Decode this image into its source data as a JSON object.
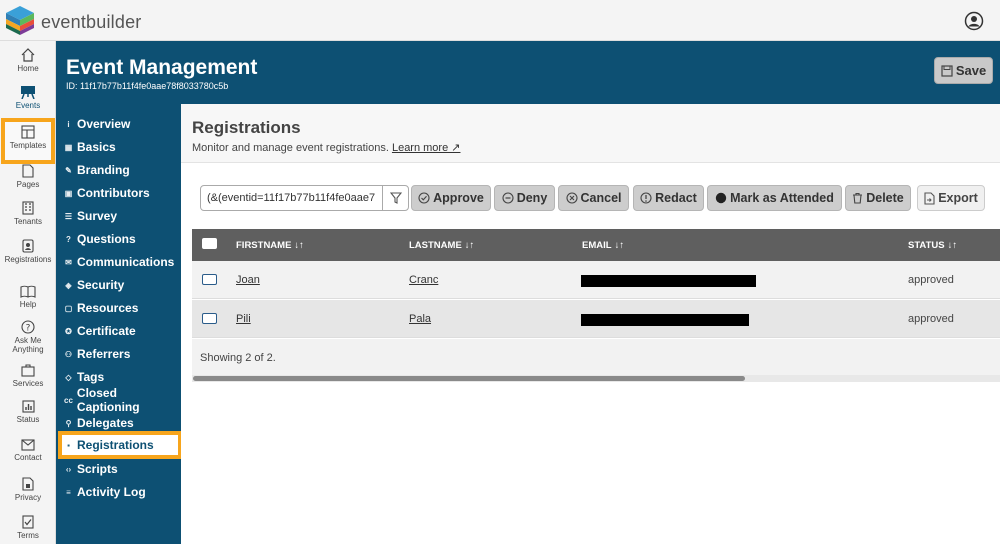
{
  "app": {
    "brand": "eventbuilder"
  },
  "rail": {
    "items": [
      {
        "label": "Home",
        "icon": "home-icon"
      },
      {
        "label": "Events",
        "icon": "easel-icon"
      },
      {
        "label": "Templates",
        "icon": "templates-icon"
      },
      {
        "label": "Pages",
        "icon": "page-icon"
      },
      {
        "label": "Tenants",
        "icon": "building-icon"
      },
      {
        "label": "Registrations",
        "icon": "badge-icon"
      },
      {
        "label": "Help",
        "icon": "book-icon"
      },
      {
        "label": "Ask Me",
        "label2": "Anything",
        "icon": "question-icon"
      },
      {
        "label": "Services",
        "icon": "bag-icon"
      },
      {
        "label": "Status",
        "icon": "chart-icon"
      },
      {
        "label": "Contact",
        "icon": "mail-icon"
      },
      {
        "label": "Privacy",
        "icon": "lock-icon"
      },
      {
        "label": "Terms",
        "icon": "check-doc-icon"
      }
    ]
  },
  "header": {
    "title": "Event Management",
    "id_text": "ID: 11f17b77b11f4fe0aae78f8033780c5b",
    "save_label": "Save"
  },
  "subnav": {
    "items": [
      {
        "label": "Overview",
        "icon": "i"
      },
      {
        "label": "Basics",
        "icon": "▦"
      },
      {
        "label": "Branding",
        "icon": "✎"
      },
      {
        "label": "Contributors",
        "icon": "▣"
      },
      {
        "label": "Survey",
        "icon": "☰"
      },
      {
        "label": "Questions",
        "icon": "?"
      },
      {
        "label": "Communications",
        "icon": "✉"
      },
      {
        "label": "Security",
        "icon": "◈"
      },
      {
        "label": "Resources",
        "icon": "▢"
      },
      {
        "label": "Certificate",
        "icon": "✪"
      },
      {
        "label": "Referrers",
        "icon": "⚇"
      },
      {
        "label": "Tags",
        "icon": "◇"
      },
      {
        "label": "Closed Captioning",
        "icon": "cc"
      },
      {
        "label": "Delegates",
        "icon": "⚲"
      },
      {
        "label": "Registrations",
        "icon": "▪"
      },
      {
        "label": "Scripts",
        "icon": "‹›"
      },
      {
        "label": "Activity Log",
        "icon": "≡"
      }
    ]
  },
  "page": {
    "title": "Registrations",
    "subtitle": "Monitor and manage event registrations.",
    "learn_more": "Learn more ↗"
  },
  "toolbar": {
    "filter_value": "(&(eventid=11f17b77b11f4fe0aae7",
    "approve": "Approve",
    "deny": "Deny",
    "cancel": "Cancel",
    "redact": "Redact",
    "attended": "Mark as Attended",
    "delete": "Delete",
    "export": "Export"
  },
  "table": {
    "columns": [
      "FIRSTNAME",
      "LASTNAME",
      "EMAIL",
      "STATUS"
    ],
    "rows": [
      {
        "firstname": "Joan",
        "lastname": "Cranc",
        "email": "",
        "status": "approved"
      },
      {
        "firstname": "Pili",
        "lastname": "Pala",
        "email": "",
        "status": "approved"
      }
    ],
    "footer": "Showing 2 of 2."
  }
}
